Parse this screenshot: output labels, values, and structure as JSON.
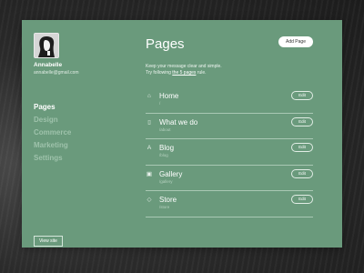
{
  "user": {
    "name": "Annabelle",
    "email": "annabelle@gmail.com"
  },
  "sidebar": {
    "items": [
      {
        "label": "Pages",
        "active": true
      },
      {
        "label": "Design",
        "active": false
      },
      {
        "label": "Commerce",
        "active": false
      },
      {
        "label": "Marketing",
        "active": false
      },
      {
        "label": "Settings",
        "active": false
      }
    ],
    "view_site_label": "View site"
  },
  "main": {
    "title": "Pages",
    "add_page_label": "Add Page",
    "intro_line1": "Keep your message clear and simple.",
    "intro_line2_prefix": "Try following ",
    "intro_line2_link": "the 5 pages",
    "intro_line2_suffix": " rule.",
    "pages": [
      {
        "name": "Home",
        "slug": "/",
        "icon": "home-icon",
        "glyph": "⌂",
        "edit_label": "Edit"
      },
      {
        "name": "What we do",
        "slug": "/about",
        "icon": "document-icon",
        "glyph": "▯",
        "edit_label": "Edit"
      },
      {
        "name": "Blog",
        "slug": "/blog",
        "icon": "text-icon",
        "glyph": "A",
        "edit_label": "Edit"
      },
      {
        "name": "Gallery",
        "slug": "/gallery",
        "icon": "image-icon",
        "glyph": "▣",
        "edit_label": "Edit"
      },
      {
        "name": "Store",
        "slug": "/store",
        "icon": "tag-icon",
        "glyph": "◇",
        "edit_label": "Edit"
      }
    ]
  },
  "colors": {
    "panel": "#6a9a7c",
    "active_nav": "#ffffff",
    "inactive_nav": "#9ec2ab"
  }
}
